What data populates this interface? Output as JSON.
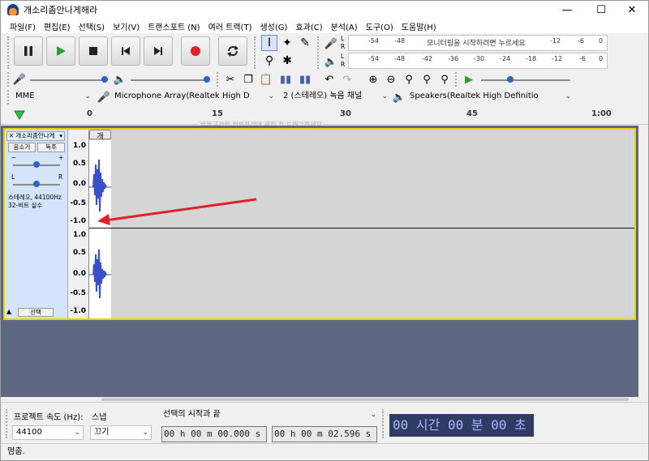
{
  "window": {
    "title": "개소리좀안나게해라"
  },
  "menu": [
    "파일(F)",
    "편집(E)",
    "선택(S)",
    "보기(V)",
    "트랜스포트 (N)",
    "여러 트랙(T)",
    "생성(G)",
    "효과(C)",
    "분석(A)",
    "도구(O)",
    "도움말(H)"
  ],
  "meters": {
    "record_ticks": [
      "-54",
      "-48",
      "모니터링을 시작하려면 누르세요",
      "-12",
      "-6",
      "0"
    ],
    "play_ticks": [
      "-54",
      "-48",
      "-42",
      "-36",
      "-30",
      "-24",
      "-18",
      "-12",
      "-6",
      "0"
    ],
    "lr": [
      "L",
      "R"
    ]
  },
  "devices": {
    "host": "MME",
    "mic": "Microphone Array(Realtek High D",
    "channels": "2 (스테레오) 녹음 채널",
    "speaker": "Speakers(Realtek High Definitio"
  },
  "timeline": {
    "labels": [
      "0",
      "15",
      "30",
      "45",
      "1:00"
    ],
    "hint": "반복구간을 정의하려면 클릭 후 드래그하세요"
  },
  "track": {
    "name": "개소리좀안나게",
    "mute": "음소거",
    "solo": "독주",
    "gain_minus": "−",
    "gain_plus": "+",
    "pan_l": "L",
    "pan_r": "R",
    "info_line1": "스테레오, 44100Hz",
    "info_line2": "32-비트 실수",
    "select": "선택",
    "clip_label": "개",
    "scale": [
      "1.0",
      "0.5",
      "0.0",
      "-0.5",
      "-1.0"
    ]
  },
  "bottom": {
    "rate_label": "프로젝트 속도 (Hz):",
    "rate_value": "44100",
    "snap_label": "스냅",
    "snap_value": "끄기",
    "sel_label": "선택의 시작과 끝",
    "sel_start": "00 h 00 m 00.000 s",
    "sel_end": "00 h 00 m 02.596 s",
    "big_time": "00 시간 00 분 00 초",
    "status": "멈춤."
  },
  "colors": {
    "accent": "#2d63c8",
    "play": "#2ca02c",
    "record": "#e0202a",
    "track_bg": "#5e6780",
    "selection_border": "#e5d500"
  }
}
